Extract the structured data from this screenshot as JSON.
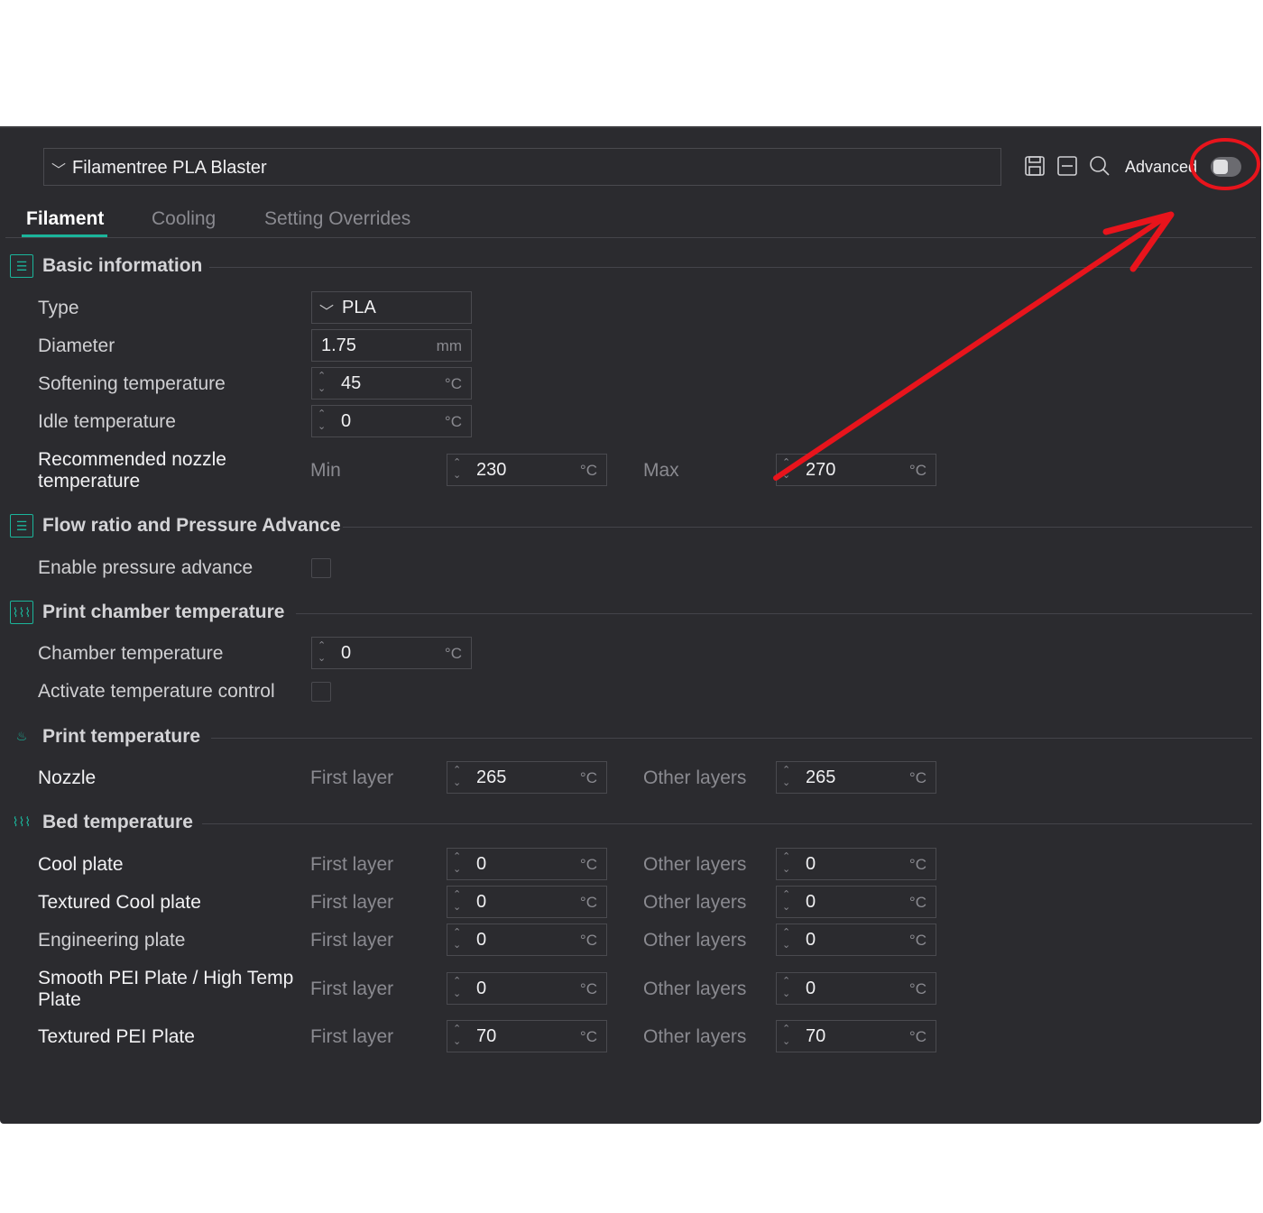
{
  "preset": {
    "name": "Filamentree PLA Blaster"
  },
  "toolbar": {
    "advanced_label": "Advanced",
    "advanced_on": false
  },
  "tabs": [
    {
      "label": "Filament",
      "active": true
    },
    {
      "label": "Cooling",
      "active": false
    },
    {
      "label": "Setting Overrides",
      "active": false
    }
  ],
  "sections": {
    "basic": {
      "title": "Basic information"
    },
    "flow": {
      "title": "Flow ratio and Pressure Advance"
    },
    "chamber": {
      "title": "Print chamber temperature"
    },
    "print_temp": {
      "title": "Print temperature"
    },
    "bed_temp": {
      "title": "Bed temperature"
    }
  },
  "basic": {
    "type": {
      "label": "Type",
      "value": "PLA"
    },
    "diameter": {
      "label": "Diameter",
      "value": "1.75",
      "unit": "mm"
    },
    "softening": {
      "label": "Softening temperature",
      "value": "45",
      "unit": "°C"
    },
    "idle": {
      "label": "Idle temperature",
      "value": "0",
      "unit": "°C"
    },
    "nozzle_rec": {
      "label_line1": "Recommended nozzle",
      "label_line2": "temperature",
      "min_label": "Min",
      "min_value": "230",
      "max_label": "Max",
      "max_value": "270",
      "unit": "°C"
    }
  },
  "flow": {
    "pressure_advance": {
      "label": "Enable pressure advance",
      "checked": false
    }
  },
  "chamber": {
    "temp": {
      "label": "Chamber temperature",
      "value": "0",
      "unit": "°C"
    },
    "control": {
      "label": "Activate temperature control",
      "checked": false
    }
  },
  "print_temp": {
    "nozzle": {
      "label": "Nozzle",
      "first_label": "First layer",
      "first_value": "265",
      "other_label": "Other layers",
      "other_value": "265",
      "unit": "°C"
    }
  },
  "bed_rows": [
    {
      "label": "Cool plate",
      "first_label": "First layer",
      "first_value": "0",
      "other_label": "Other layers",
      "other_value": "0",
      "unit": "°C"
    },
    {
      "label": "Textured Cool plate",
      "first_label": "First layer",
      "first_value": "0",
      "other_label": "Other layers",
      "other_value": "0",
      "unit": "°C"
    },
    {
      "label": "Engineering plate",
      "first_label": "First layer",
      "first_value": "0",
      "other_label": "Other layers",
      "other_value": "0",
      "unit": "°C"
    },
    {
      "label_line1": "Smooth PEI Plate / High Temp",
      "label_line2": "Plate",
      "first_label": "First layer",
      "first_value": "0",
      "other_label": "Other layers",
      "other_value": "0",
      "unit": "°C"
    },
    {
      "label": "Textured PEI Plate",
      "first_label": "First layer",
      "first_value": "70",
      "other_label": "Other layers",
      "other_value": "70",
      "unit": "°C"
    }
  ],
  "annotation": {
    "color": "#e8141c"
  }
}
